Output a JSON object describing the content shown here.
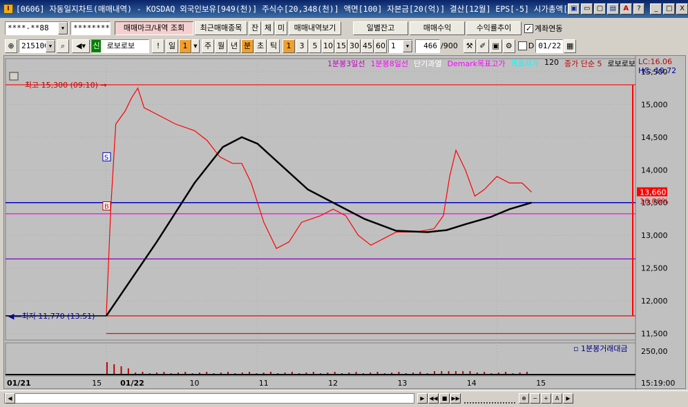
{
  "titlebar": {
    "text": "[0606] 자동일지차트(매매내역) - KOSDAQ 외국인보유[949(천)] 주식수[20,348(천)] 액면[100] 자본금[20(억)] 결산[12월] EPS[-5] 시가총액[2",
    "buttons": [
      "▣",
      "▭",
      "▢",
      "▤",
      "A",
      "?",
      "_",
      "□",
      "X"
    ]
  },
  "toolbar1": {
    "account": "****-**88",
    "password": "********",
    "trade_mark_btn": "매매마크/내역 조회",
    "recent_trades_btn": "최근매매종목",
    "tab_jan": "잔",
    "tab_che": "체",
    "tab_mi": "미",
    "trade_history_btn": "매매내역보기",
    "daily_balance_btn": "일별잔고",
    "trade_profit_btn": "매매수익",
    "return_trend_btn": "수익률추이",
    "account_link_label": "계좌연동"
  },
  "toolbar2": {
    "code": "215100",
    "market_badge": "신",
    "stock_name": "로보로보",
    "period_day": "일",
    "period_num": "1",
    "period_week": "주",
    "period_month": "월",
    "period_year": "년",
    "period_min": "분",
    "period_tick": "초",
    "period_t": "틱",
    "intervals": [
      "1",
      "3",
      "5",
      "10",
      "15",
      "30",
      "45",
      "60"
    ],
    "interval_value": "1",
    "count": "466",
    "count_total": "/900",
    "date_value": "01/22"
  },
  "legend": {
    "ma3": "1분봉3일선",
    "ma8": "1분봉8일선",
    "short_over": "단기과열",
    "demark": "Demark목표고가",
    "target": "목표저가",
    "num120": "120",
    "close": "종가 단순 5",
    "stock": "로보로보"
  },
  "side_readout": {
    "lc": "LC:16.06",
    "hc": "HC:-10.72",
    "current_price": "13,660",
    "current_pct": "16.06%"
  },
  "chart_data": {
    "type": "line",
    "y_axis_ticks": [
      "15,500",
      "15,000",
      "14,500",
      "14,000",
      "13,500",
      "13,000",
      "12,500",
      "12,000",
      "11,500"
    ],
    "ylim": [
      11400,
      15700
    ],
    "x_axis_labels": [
      "01/21",
      "15",
      "01/22",
      "10",
      "11",
      "12",
      "13",
      "14",
      "15"
    ],
    "time_readout": "15:19:00",
    "high_annotation": "최고 15,300 (09:10)",
    "low_annotation": "최저 11,770 (13:51)",
    "volume_tick": "250,00",
    "volume_legend": "1분봉거래대금",
    "lines": [
      {
        "label": "high",
        "value": 15300,
        "color": "#ff0000"
      },
      {
        "label": "low",
        "value": 11770,
        "color": "#ff0000"
      },
      {
        "label": "blue",
        "value": 13500,
        "color": "#0000c0"
      },
      {
        "label": "magenta",
        "value": 13330,
        "color": "#ff00ff"
      },
      {
        "label": "purple",
        "value": 12640,
        "color": "#8000c0"
      },
      {
        "label": "red-low",
        "value": 11500,
        "color": "#ff0000"
      }
    ],
    "price": [
      [
        0.16,
        11770
      ],
      [
        0.167,
        13400
      ],
      [
        0.175,
        14700
      ],
      [
        0.19,
        14900
      ],
      [
        0.2,
        15100
      ],
      [
        0.21,
        15250
      ],
      [
        0.22,
        14950
      ],
      [
        0.24,
        14850
      ],
      [
        0.27,
        14700
      ],
      [
        0.3,
        14600
      ],
      [
        0.32,
        14450
      ],
      [
        0.34,
        14200
      ],
      [
        0.36,
        14100
      ],
      [
        0.375,
        14100
      ],
      [
        0.39,
        13800
      ],
      [
        0.41,
        13200
      ],
      [
        0.43,
        12800
      ],
      [
        0.45,
        12900
      ],
      [
        0.47,
        13200
      ],
      [
        0.5,
        13300
      ],
      [
        0.52,
        13400
      ],
      [
        0.54,
        13300
      ],
      [
        0.56,
        13000
      ],
      [
        0.58,
        12850
      ],
      [
        0.6,
        12950
      ],
      [
        0.62,
        13050
      ],
      [
        0.65,
        13050
      ],
      [
        0.68,
        13100
      ],
      [
        0.695,
        13300
      ],
      [
        0.705,
        13900
      ],
      [
        0.715,
        14300
      ],
      [
        0.73,
        14000
      ],
      [
        0.745,
        13600
      ],
      [
        0.76,
        13700
      ],
      [
        0.78,
        13900
      ],
      [
        0.8,
        13800
      ],
      [
        0.82,
        13800
      ],
      [
        0.835,
        13660
      ]
    ],
    "ma_line": [
      [
        0.16,
        11770
      ],
      [
        0.24,
        12900
      ],
      [
        0.3,
        13800
      ],
      [
        0.345,
        14350
      ],
      [
        0.375,
        14500
      ],
      [
        0.4,
        14400
      ],
      [
        0.44,
        14050
      ],
      [
        0.48,
        13700
      ],
      [
        0.52,
        13500
      ],
      [
        0.57,
        13250
      ],
      [
        0.62,
        13070
      ],
      [
        0.67,
        13050
      ],
      [
        0.7,
        13080
      ],
      [
        0.73,
        13170
      ],
      [
        0.77,
        13280
      ],
      [
        0.8,
        13400
      ],
      [
        0.835,
        13500
      ]
    ]
  },
  "colors": {
    "chart_bg": "#c0c0c0",
    "price_line": "#ff0000",
    "ma_line": "#000000"
  }
}
